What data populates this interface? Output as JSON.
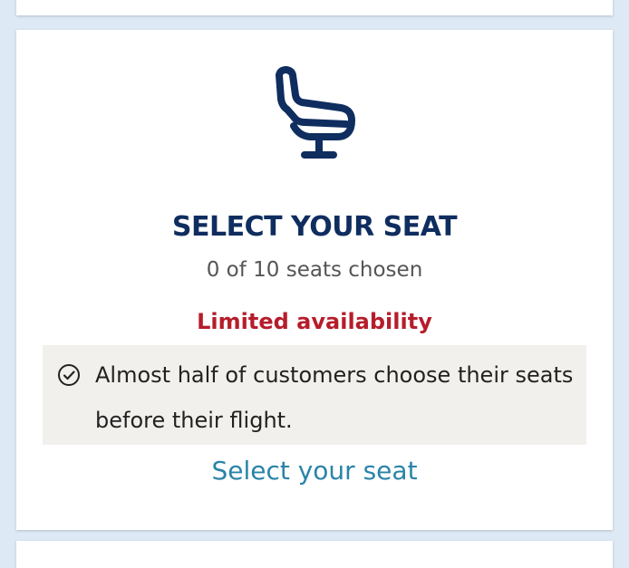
{
  "seat_card": {
    "icon": "seat-icon",
    "title": "SELECT YOUR SEAT",
    "seats_chosen_text": "0 of 10 seats chosen",
    "availability_text": "Limited availability",
    "info": {
      "icon": "check-circle-icon",
      "text": "Almost half of customers choose their seats before their flight."
    },
    "select_link_label": "Select your seat"
  },
  "colors": {
    "page_background": "#dde9f5",
    "title": "#0f2d5f",
    "availability": "#b61d2b",
    "link": "#2a84a8",
    "info_background": "#f2f0ec"
  }
}
